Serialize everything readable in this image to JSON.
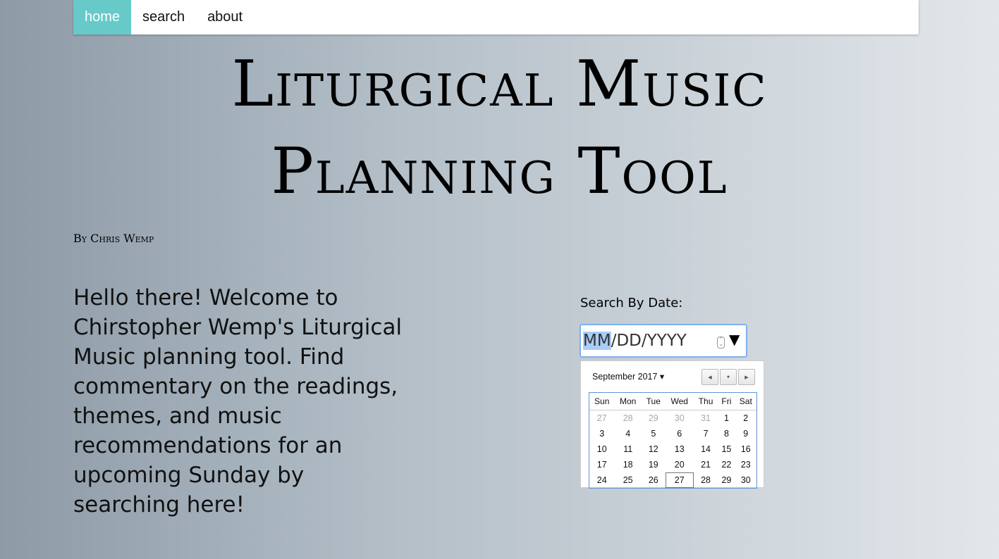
{
  "nav": {
    "items": [
      "home",
      "search",
      "about"
    ],
    "active": "home"
  },
  "title": {
    "line1": "Liturgical Music",
    "line2": "Planning Tool"
  },
  "byline": "By Chris Wemp",
  "intro": "Hello there! Welcome to Chirstopher Wemp's Liturgical Music planning tool. Find commentary on the readings, themes, and music recommendations for an upcoming Sunday by searching here!",
  "search": {
    "label": "Search By Date:",
    "mm": "MM",
    "rest": "/DD/YYYY",
    "arrow": "▼"
  },
  "calendar": {
    "month": "September 2017",
    "weekdays": [
      "Sun",
      "Mon",
      "Tue",
      "Wed",
      "Thu",
      "Fri",
      "Sat"
    ],
    "weeks": [
      [
        "27",
        "28",
        "29",
        "30",
        "31",
        "1",
        "2"
      ],
      [
        "3",
        "4",
        "5",
        "6",
        "7",
        "8",
        "9"
      ],
      [
        "10",
        "11",
        "12",
        "13",
        "14",
        "15",
        "16"
      ],
      [
        "17",
        "18",
        "19",
        "20",
        "21",
        "22",
        "23"
      ],
      [
        "24",
        "25",
        "26",
        "27",
        "28",
        "29",
        "30"
      ]
    ],
    "today": "27"
  },
  "colors": {
    "nav_active": "#68c9c9",
    "input_focus": "#7fb0f0"
  }
}
